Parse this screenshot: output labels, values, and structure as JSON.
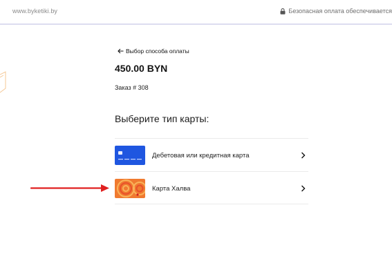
{
  "header": {
    "site_url": "www.byketiki.by",
    "secure_text": "Безопасная оплата обеспечивается"
  },
  "payment": {
    "back_label": "Выбор способа оплаты",
    "amount": "450.00 BYN",
    "order_label": "Заказ # 308",
    "choose_title": "Выберите тип карты:"
  },
  "card_types": [
    {
      "label": "Дебетовая или кредитная карта",
      "icon": "bank-card-icon"
    },
    {
      "label": "Карта Халва",
      "icon": "halva-card-icon"
    }
  ],
  "annotations": {
    "arrow_color": "#e02020",
    "points_to": "Карта Халва"
  },
  "colors": {
    "bank_card": "#1f56e0",
    "halva_card": "#f07a30",
    "divider": "#ebebeb",
    "topbar_border": "#dcdcf0"
  }
}
